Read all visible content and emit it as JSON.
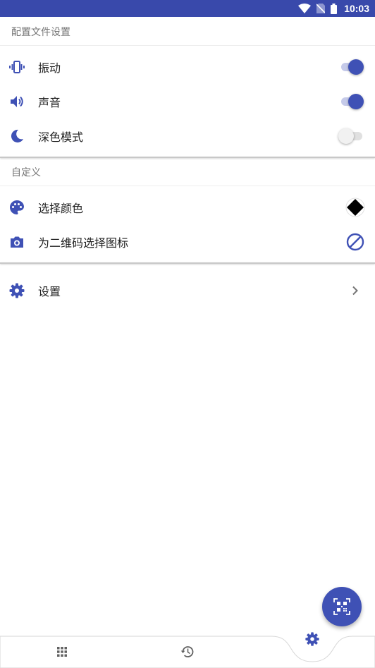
{
  "status_bar": {
    "time": "10:03"
  },
  "sections": {
    "profile": {
      "header": "配置文件设置"
    },
    "custom": {
      "header": "自定义"
    }
  },
  "rows": {
    "vibrate": {
      "label": "振动",
      "enabled": true
    },
    "sound": {
      "label": "声音",
      "enabled": true
    },
    "dark_mode": {
      "label": "深色模式",
      "enabled": false
    },
    "pick_color": {
      "label": "选择颜色",
      "selected_color": "#000000"
    },
    "qr_icon": {
      "label": "为二维码选择图标"
    },
    "settings": {
      "label": "设置"
    }
  },
  "icons": {
    "vibrate": "vibrate-icon",
    "sound": "volume-icon",
    "dark_mode": "moon-icon",
    "pick_color": "palette-icon",
    "qr_icon": "camera-icon",
    "settings": "gear-icon",
    "no_icon": "block-icon",
    "fab": "qr-code-icon",
    "nav_left": "grid-icon",
    "nav_mid": "history-icon",
    "nav_right": "gear-icon"
  },
  "colors": {
    "primary": "#3f51b5",
    "status_bar": "#3949ab",
    "switch_track_on": "#c5cae9",
    "secondary_text": "#757575"
  }
}
